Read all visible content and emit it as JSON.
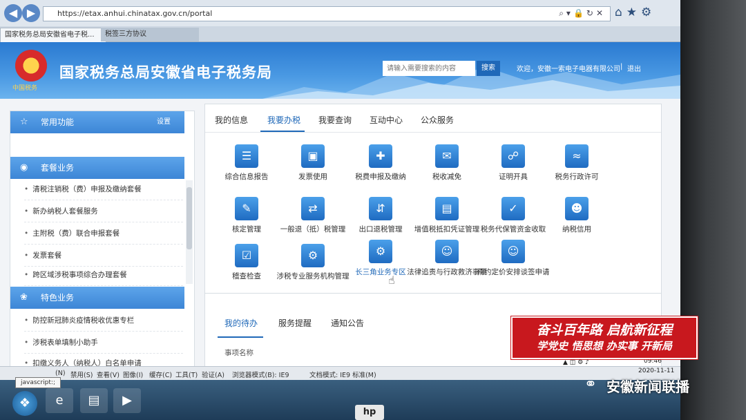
{
  "browser": {
    "url": "https://etax.anhui.chinatax.gov.cn/portal",
    "tabs": [
      "国家税务总局安徽省电子税...",
      "税签三方协议"
    ],
    "tab_close": "×"
  },
  "header": {
    "title": "国家税务总局安徽省电子税务局",
    "emblem_caption": "中国税务",
    "search_placeholder": "请输入需要搜索的内容",
    "search_button": "搜索",
    "welcome": "欢迎，安徽一索电子电器有限公司",
    "separator": "|",
    "logout": "退出"
  },
  "sidebar": {
    "sections": [
      {
        "title": "常用功能",
        "action": "设置",
        "items": []
      },
      {
        "title": "套餐业务",
        "items": [
          "清税注销税（费）申报及缴纳套餐",
          "新办纳税人套餐服务",
          "主附税（费）联合申报套餐",
          "发票套餐",
          "跨区域涉税事项综合办理套餐"
        ]
      },
      {
        "title": "特色业务",
        "items": [
          "防控新冠肺炎疫情税收优惠专栏",
          "涉税表单填制小助手",
          "扣缴义务人（纳税人）白名单申请"
        ]
      }
    ]
  },
  "main": {
    "tabs": [
      "我的信息",
      "我要办税",
      "我要查询",
      "互动中心",
      "公众服务"
    ],
    "active_tab": "我要办税",
    "services": [
      {
        "label": "综合信息报告",
        "icon": "report-icon"
      },
      {
        "label": "发票使用",
        "icon": "invoice-icon"
      },
      {
        "label": "税费申报及缴纳",
        "icon": "declare-icon"
      },
      {
        "label": "税收减免",
        "icon": "relief-icon"
      },
      {
        "label": "证明开具",
        "icon": "certificate-icon"
      },
      {
        "label": "税务行政许可",
        "icon": "chart-icon"
      },
      {
        "label": "核定管理",
        "icon": "approval-icon"
      },
      {
        "label": "一般退（抵）税管理",
        "icon": "refund-icon"
      },
      {
        "label": "出口退税管理",
        "icon": "export-icon"
      },
      {
        "label": "增值税抵扣凭证管理",
        "icon": "deduction-icon"
      },
      {
        "label": "税务代保管资金收取",
        "icon": "custody-icon"
      },
      {
        "label": "纳税信用",
        "icon": "credit-icon"
      },
      {
        "label": "稽查检查",
        "icon": "inspection-icon"
      },
      {
        "label": "涉税专业服务机构管理",
        "icon": "agency-icon"
      },
      {
        "label": "长三角业务专区",
        "icon": "region-icon"
      },
      {
        "label": "法律追责与行政救济事项",
        "icon": "legal-icon"
      },
      {
        "label": "预约定价安排谈签申请",
        "icon": "pricing-icon"
      }
    ]
  },
  "lower": {
    "tabs": [
      "我的待办",
      "服务提醒",
      "通知公告"
    ],
    "column": "事项名称"
  },
  "badge": {
    "line1": "奋斗百年路 启航新征程",
    "line2": "学党史 悟思想 办实事 开新局",
    "color": "#c8181e"
  },
  "statusbar": {
    "menu": [
      "(N)",
      "禁用(S)",
      "查看(V)",
      "图像(I)",
      "缓存(C)",
      "工具(T)",
      "验证(A)"
    ],
    "browser_mode": "浏览器模式(B): IE9",
    "doc_mode": "文档模式: IE9 标准(M)",
    "tooltip": "javascript:;"
  },
  "taskbar": {
    "time": "09:46",
    "date": "2020-11-11",
    "brand": "hp"
  },
  "watermark": {
    "text": "安徽新闻联播"
  }
}
